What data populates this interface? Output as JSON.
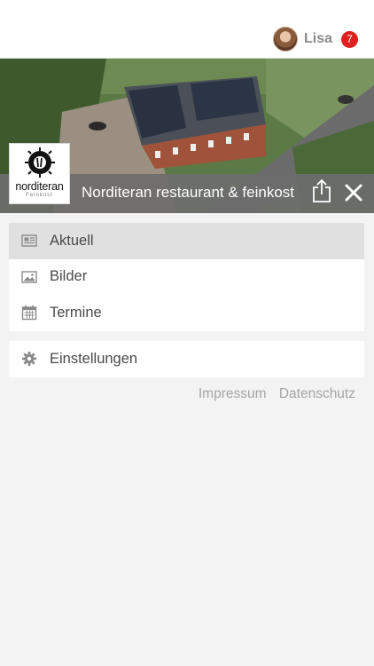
{
  "user": {
    "name": "Lisa",
    "notifications": "7"
  },
  "restaurant": {
    "title": "Norditeran restaurant & feinkost",
    "logo_text": "norditeran",
    "logo_sub": "Feinkost"
  },
  "menu": {
    "primary": [
      {
        "label": "Aktuell",
        "icon": "newspaper-icon",
        "active": true
      },
      {
        "label": "Bilder",
        "icon": "image-icon",
        "active": false
      },
      {
        "label": "Termine",
        "icon": "calendar-icon",
        "active": false
      }
    ],
    "secondary": [
      {
        "label": "Einstellungen",
        "icon": "gear-icon"
      }
    ]
  },
  "footer": {
    "impressum": "Impressum",
    "datenschutz": "Datenschutz"
  },
  "colors": {
    "badge": "#e02020",
    "header_strip": "#6c6c6c",
    "active_item": "#e0e0e0"
  }
}
